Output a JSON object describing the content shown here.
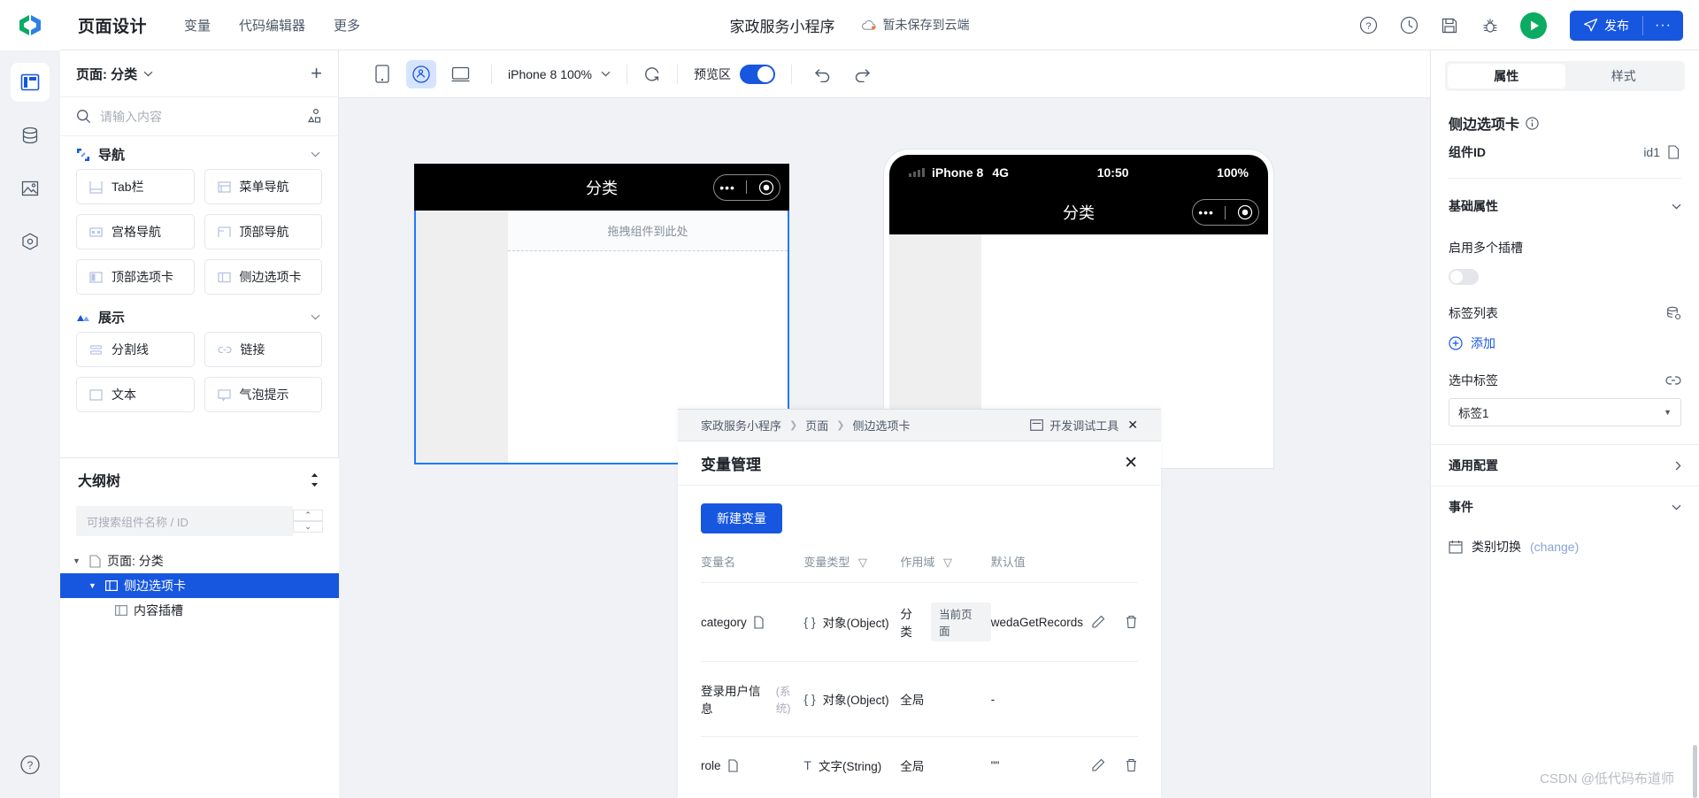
{
  "header": {
    "logo": "weda-logo-icon",
    "title": "页面设计",
    "nav": [
      {
        "label": "变量"
      },
      {
        "label": "代码编辑器"
      },
      {
        "label": "更多"
      }
    ],
    "project_name": "家政服务小程序",
    "save_state": "暂未保存到云端",
    "actions": [
      {
        "name": "help-icon"
      },
      {
        "name": "history-icon"
      },
      {
        "name": "save-icon"
      },
      {
        "name": "bug-icon"
      }
    ],
    "run_label": "run-icon",
    "publish_label": "发布",
    "publish_more": "···"
  },
  "rail": {
    "items": [
      {
        "name": "layout-icon",
        "active": true
      },
      {
        "name": "database-icon",
        "active": false
      },
      {
        "name": "image-icon",
        "active": false
      },
      {
        "name": "plugin-icon",
        "active": false
      }
    ],
    "help": "help-circle-icon"
  },
  "left_panel": {
    "page_label": "页面: 分类",
    "add_label": "+",
    "search_placeholder": "请输入内容",
    "tree_toggle_icon": "hierarchy-icon",
    "groups": [
      {
        "title": "导航",
        "items": [
          {
            "label": "Tab栏",
            "icon": "tabbar-icon"
          },
          {
            "label": "菜单导航",
            "icon": "menu-nav-icon"
          },
          {
            "label": "宫格导航",
            "icon": "grid-nav-icon"
          },
          {
            "label": "顶部导航",
            "icon": "top-nav-icon"
          },
          {
            "label": "顶部选项卡",
            "icon": "top-tabs-icon"
          },
          {
            "label": "侧边选项卡",
            "icon": "side-tabs-icon"
          }
        ]
      },
      {
        "title": "展示",
        "items": [
          {
            "label": "分割线",
            "icon": "divider-icon"
          },
          {
            "label": "链接",
            "icon": "link-icon"
          },
          {
            "label": "文本",
            "icon": "text-icon"
          },
          {
            "label": "气泡提示",
            "icon": "tooltip-icon"
          }
        ]
      }
    ]
  },
  "outline": {
    "title": "大纲树",
    "sort_icon": "sort-icon",
    "search_placeholder": "可搜索组件名称 / ID",
    "nodes": [
      {
        "label": "页面: 分类",
        "depth": 0,
        "icon": "page-icon",
        "selected": false
      },
      {
        "label": "侧边选项卡",
        "depth": 1,
        "icon": "side-tabs-icon",
        "selected": true
      },
      {
        "label": "内容插槽",
        "depth": 2,
        "icon": "slot-icon",
        "selected": false
      }
    ]
  },
  "canvas_toolbar": {
    "views": [
      {
        "name": "phone-view-icon",
        "active": false
      },
      {
        "name": "miniprogram-view-icon",
        "active": true
      },
      {
        "name": "desktop-view-icon",
        "active": false
      }
    ],
    "device": "iPhone 8 100%",
    "refresh_icon": "refresh-icon",
    "preview_label": "预览区",
    "preview_on": true,
    "undo_icon": "undo-icon",
    "redo_icon": "redo-icon"
  },
  "design_phone": {
    "nav_title": "分类",
    "capsule_dots": "•••",
    "drop_hint": "拖拽组件到此处"
  },
  "preview_phone": {
    "carrier": "iPhone 8",
    "network": "4G",
    "time": "10:50",
    "battery": "100%",
    "nav_title": "分类",
    "capsule_dots": "•••"
  },
  "dock": {
    "breadcrumb": [
      "家政服务小程序",
      "页面",
      "侧边选项卡"
    ],
    "debug_tool": "开发调试工具",
    "debug_close": "✕",
    "title": "变量管理",
    "close": "✕",
    "new_button": "新建变量",
    "columns": [
      {
        "label": "变量名",
        "filter": false
      },
      {
        "label": "变量类型",
        "filter": true
      },
      {
        "label": "作用域",
        "filter": true
      },
      {
        "label": "默认值",
        "filter": false
      }
    ],
    "rows": [
      {
        "name": "category",
        "has_copy": true,
        "system": "",
        "type_brace": "{ }",
        "type": "对象(Object)",
        "scope": "分类",
        "scope_badge": "当前页面",
        "default": "wedaGetRecords",
        "actions": [
          "edit-icon",
          "delete-icon"
        ]
      },
      {
        "name": "登录用户信息",
        "has_copy": false,
        "system": "(系统)",
        "type_brace": "{ }",
        "type": "对象(Object)",
        "scope": "全局",
        "scope_badge": "",
        "default": "-",
        "actions": []
      },
      {
        "name": "role",
        "has_copy": true,
        "system": "",
        "type_brace": "T",
        "type": "文字(String)",
        "scope": "全局",
        "scope_badge": "",
        "default": "\"\"",
        "actions": [
          "edit-icon",
          "delete-icon"
        ]
      }
    ]
  },
  "right_panel": {
    "tabs": [
      {
        "label": "属性",
        "active": true
      },
      {
        "label": "样式",
        "active": false
      }
    ],
    "component_name": "侧边选项卡",
    "info_icon": "info-icon",
    "component_id_label": "组件ID",
    "component_id": "id1",
    "copy_icon": "copy-icon",
    "sections": [
      {
        "label": "基础属性",
        "expanded": true
      },
      {
        "label": "通用配置",
        "expanded": false
      },
      {
        "label": "事件",
        "expanded": true
      }
    ],
    "multi_slot_label": "启用多个插槽",
    "multi_slot_on": false,
    "tag_list_label": "标签列表",
    "tag_list_icon": "data-source-icon",
    "add_label": "添加",
    "selected_tag_label": "选中标签",
    "selected_tag_link_icon": "link-icon",
    "selected_tag_value": "标签1",
    "event_name": "类别切换",
    "event_type": "(change)",
    "event_icon": "calendar-icon"
  },
  "watermark": "CSDN @低代码布道师",
  "colors": {
    "accent": "#1757e0",
    "green": "#0aab63",
    "panel_bg": "#f0f2f5",
    "border": "#e5e6eb"
  }
}
